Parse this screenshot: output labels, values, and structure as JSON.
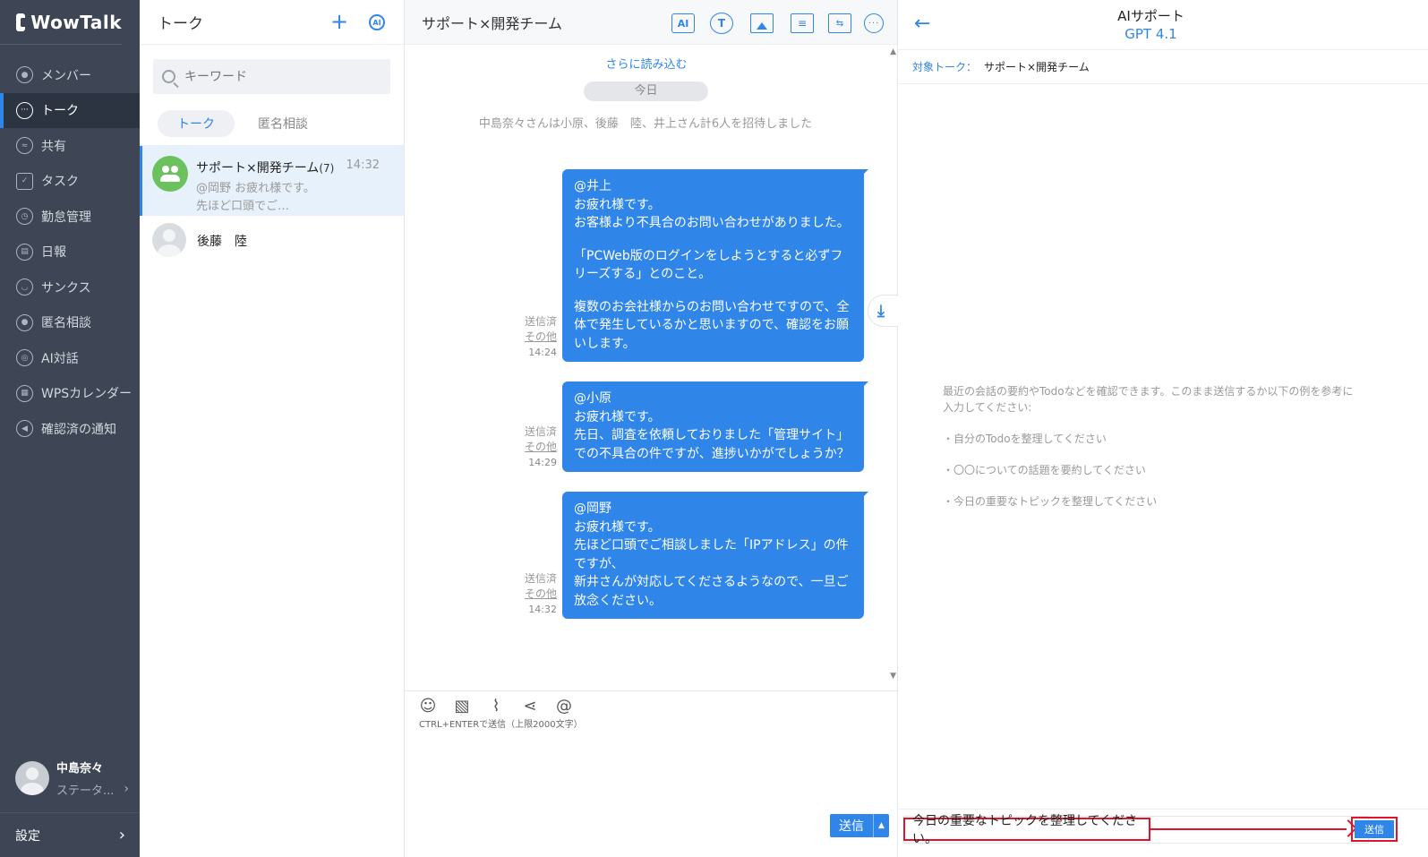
{
  "app": {
    "logo_text": "WowTalk"
  },
  "nav": {
    "items": [
      {
        "label": "メンバー",
        "icon": "member-icon"
      },
      {
        "label": "トーク",
        "icon": "talk-icon"
      },
      {
        "label": "共有",
        "icon": "share-icon"
      },
      {
        "label": "タスク",
        "icon": "task-icon"
      },
      {
        "label": "勤怠管理",
        "icon": "attendance-icon"
      },
      {
        "label": "日報",
        "icon": "daily-report-icon"
      },
      {
        "label": "サンクス",
        "icon": "thanks-icon"
      },
      {
        "label": "匿名相談",
        "icon": "anonymous-icon"
      },
      {
        "label": "AI対話",
        "icon": "ai-icon"
      },
      {
        "label": "WPSカレンダー",
        "icon": "calendar-icon"
      },
      {
        "label": "確認済の通知",
        "icon": "notification-icon"
      }
    ],
    "user": {
      "name": "中島奈々",
      "status": "ステータ..."
    },
    "settings_label": "設定"
  },
  "talk_list": {
    "title": "トーク",
    "search_placeholder": "キーワード",
    "tabs": [
      "トーク",
      "匿名相談"
    ],
    "items": [
      {
        "name": "サポート×開発チーム",
        "count": "(7)",
        "time": "14:32",
        "preview_1": "@岡野 お疲れ様です。",
        "preview_2": "先ほど口頭でご…"
      },
      {
        "name": "後藤　陸"
      }
    ]
  },
  "chat": {
    "title": "サポート×開発チーム",
    "load_more": "さらに読み込む",
    "date_divider": "今日",
    "system_message": "中島奈々さんは小原、後藤　陸、井上さん計6人を招待しました",
    "messages": [
      {
        "p1": "@井上",
        "p2": "お疲れ様です。",
        "p3": "お客様より不具合のお問い合わせがありました。",
        "p4": "「PCWeb版のログインをしようとすると必ずフリーズする」とのこと。",
        "p5": "複数のお会社様からのお問い合わせですので、全体で発生しているかと思いますので、確認をお願いします。",
        "status": "送信済",
        "other": "その他",
        "time": "14:24"
      },
      {
        "p1": "@小原",
        "p2": "お疲れ様です。",
        "p3": "先日、調査を依頼しておりました「管理サイト」での不具合の件ですが、進捗いかがでしょうか？",
        "status": "送信済",
        "other": "その他",
        "time": "14:29"
      },
      {
        "p1": "@岡野",
        "p2": "お疲れ様です。",
        "p3": "先ほど口頭でご相談しました「IPアドレス」の件ですが、",
        "p4": "新井さんが対応してくださるようなので、一旦ご放念ください。",
        "status": "送信済",
        "other": "その他",
        "time": "14:32"
      }
    ],
    "composer_hint": "CTRL+ENTERで送信（上限2000文字）",
    "send_label": "送信"
  },
  "ai_panel": {
    "title": "AIサポート",
    "model": "GPT 4.1",
    "target_label": "対象トーク：",
    "target_value": "サポート×開発チーム",
    "guide_text": "最近の会話の要約やTodoなどを確認できます。このまま送信するか以下の例を参考に入力してください:",
    "examples": [
      "・自分のTodoを整理してください",
      "・〇〇についての話題を要約してください",
      "・今日の重要なトピックを整理してください"
    ],
    "input_value": "今日の重要なトピックを整理してください。",
    "send_label": "送信"
  },
  "colors": {
    "accent": "#2f86e8",
    "nav_bg": "#3e4655",
    "highlight": "#e0152b"
  }
}
